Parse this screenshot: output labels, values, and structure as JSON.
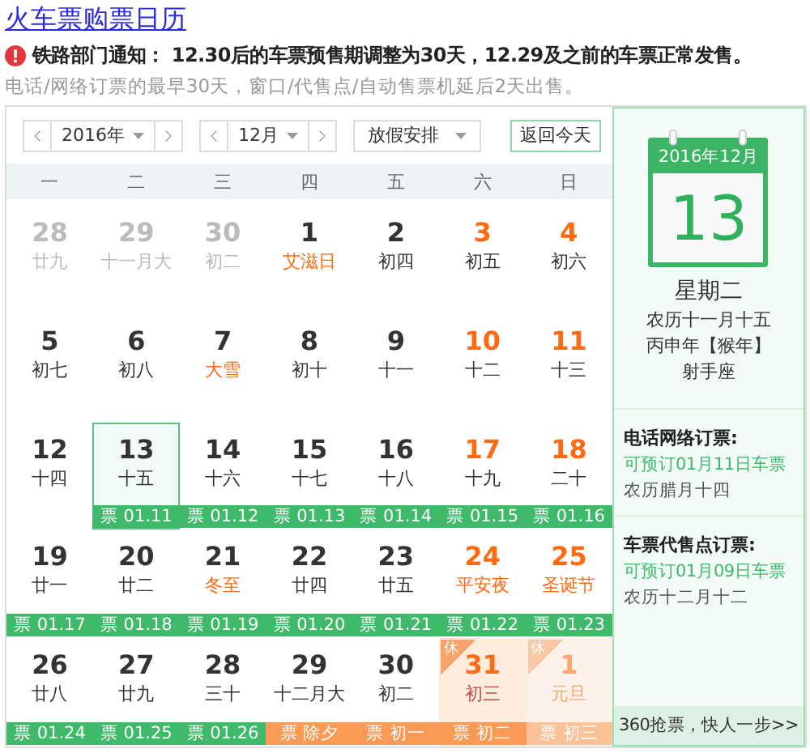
{
  "title": "火车票购票日历",
  "notice": {
    "label": "铁路部门通知：",
    "text": "12.30后的车票预售期调整为30天，12.29及之前的车票正常发售。"
  },
  "subtitle": "电话/网络订票的最早30天，窗口/代售点/自动售票机延后2天出售。",
  "toolbar": {
    "year": "2016年",
    "month": "12月",
    "holiday_select": "放假安排",
    "today_button": "返回今天"
  },
  "weekdays": [
    "一",
    "二",
    "三",
    "四",
    "五",
    "六",
    "日"
  ],
  "weeks": [
    [
      {
        "day": "28",
        "lunar": "廿九",
        "other_month": true,
        "weekend": false,
        "festival": false
      },
      {
        "day": "29",
        "lunar": "十一月大",
        "other_month": true,
        "weekend": false,
        "festival": false
      },
      {
        "day": "30",
        "lunar": "初二",
        "other_month": true,
        "weekend": false,
        "festival": false
      },
      {
        "day": "1",
        "lunar": "艾滋日",
        "other_month": false,
        "weekend": false,
        "festival": true
      },
      {
        "day": "2",
        "lunar": "初四",
        "other_month": false,
        "weekend": false,
        "festival": false
      },
      {
        "day": "3",
        "lunar": "初五",
        "other_month": false,
        "weekend": true,
        "festival": false
      },
      {
        "day": "4",
        "lunar": "初六",
        "other_month": false,
        "weekend": true,
        "festival": false
      }
    ],
    [
      {
        "day": "5",
        "lunar": "初七",
        "other_month": false,
        "weekend": false,
        "festival": false
      },
      {
        "day": "6",
        "lunar": "初八",
        "other_month": false,
        "weekend": false,
        "festival": false
      },
      {
        "day": "7",
        "lunar": "大雪",
        "other_month": false,
        "weekend": false,
        "festival": true
      },
      {
        "day": "8",
        "lunar": "初十",
        "other_month": false,
        "weekend": false,
        "festival": false
      },
      {
        "day": "9",
        "lunar": "十一",
        "other_month": false,
        "weekend": false,
        "festival": false
      },
      {
        "day": "10",
        "lunar": "十二",
        "other_month": false,
        "weekend": true,
        "festival": false
      },
      {
        "day": "11",
        "lunar": "十三",
        "other_month": false,
        "weekend": true,
        "festival": false
      }
    ],
    [
      {
        "day": "12",
        "lunar": "十四",
        "other_month": false,
        "weekend": false,
        "festival": false
      },
      {
        "day": "13",
        "lunar": "十五",
        "other_month": false,
        "weekend": false,
        "festival": false,
        "selected": true,
        "ticket": {
          "text": "票 01.11",
          "kind": "regular"
        }
      },
      {
        "day": "14",
        "lunar": "十六",
        "other_month": false,
        "weekend": false,
        "festival": false,
        "ticket": {
          "text": "票 01.12",
          "kind": "regular"
        }
      },
      {
        "day": "15",
        "lunar": "十七",
        "other_month": false,
        "weekend": false,
        "festival": false,
        "ticket": {
          "text": "票 01.13",
          "kind": "regular"
        }
      },
      {
        "day": "16",
        "lunar": "十八",
        "other_month": false,
        "weekend": false,
        "festival": false,
        "ticket": {
          "text": "票 01.14",
          "kind": "regular"
        }
      },
      {
        "day": "17",
        "lunar": "十九",
        "other_month": false,
        "weekend": true,
        "festival": false,
        "ticket": {
          "text": "票 01.15",
          "kind": "regular"
        }
      },
      {
        "day": "18",
        "lunar": "二十",
        "other_month": false,
        "weekend": true,
        "festival": false,
        "ticket": {
          "text": "票 01.16",
          "kind": "regular"
        }
      }
    ],
    [
      {
        "day": "19",
        "lunar": "廿一",
        "other_month": false,
        "weekend": false,
        "festival": false,
        "ticket": {
          "text": "票 01.17",
          "kind": "regular"
        }
      },
      {
        "day": "20",
        "lunar": "廿二",
        "other_month": false,
        "weekend": false,
        "festival": false,
        "ticket": {
          "text": "票 01.18",
          "kind": "regular"
        }
      },
      {
        "day": "21",
        "lunar": "冬至",
        "other_month": false,
        "weekend": false,
        "festival": true,
        "ticket": {
          "text": "票 01.19",
          "kind": "regular"
        }
      },
      {
        "day": "22",
        "lunar": "廿四",
        "other_month": false,
        "weekend": false,
        "festival": false,
        "ticket": {
          "text": "票 01.20",
          "kind": "regular"
        }
      },
      {
        "day": "23",
        "lunar": "廿五",
        "other_month": false,
        "weekend": false,
        "festival": false,
        "ticket": {
          "text": "票 01.21",
          "kind": "regular"
        }
      },
      {
        "day": "24",
        "lunar": "平安夜",
        "other_month": false,
        "weekend": true,
        "festival": true,
        "ticket": {
          "text": "票 01.22",
          "kind": "regular"
        }
      },
      {
        "day": "25",
        "lunar": "圣诞节",
        "other_month": false,
        "weekend": true,
        "festival": true,
        "ticket": {
          "text": "票 01.23",
          "kind": "regular"
        }
      }
    ],
    [
      {
        "day": "26",
        "lunar": "廿八",
        "other_month": false,
        "weekend": false,
        "festival": false,
        "ticket": {
          "text": "票 01.24",
          "kind": "regular"
        }
      },
      {
        "day": "27",
        "lunar": "廿九",
        "other_month": false,
        "weekend": false,
        "festival": false,
        "ticket": {
          "text": "票 01.25",
          "kind": "regular"
        }
      },
      {
        "day": "28",
        "lunar": "三十",
        "other_month": false,
        "weekend": false,
        "festival": false,
        "ticket": {
          "text": "票 01.26",
          "kind": "regular"
        }
      },
      {
        "day": "29",
        "lunar": "十二月大",
        "other_month": false,
        "weekend": false,
        "festival": false,
        "ticket": {
          "text": "票 除夕",
          "kind": "spring"
        }
      },
      {
        "day": "30",
        "lunar": "初二",
        "other_month": false,
        "weekend": false,
        "festival": false,
        "ticket": {
          "text": "票 初一",
          "kind": "spring"
        }
      },
      {
        "day": "31",
        "lunar": "初三",
        "other_month": false,
        "weekend": true,
        "festival": false,
        "rest": "休",
        "ticket": {
          "text": "票 初二",
          "kind": "spring"
        }
      },
      {
        "day": "1",
        "lunar": "元旦",
        "other_month": true,
        "weekend": true,
        "festival": true,
        "rest": "休",
        "ticket": {
          "text": "票 初三",
          "kind": "spring"
        }
      }
    ]
  ],
  "side": {
    "month": "2016年12月",
    "day": "13",
    "weekday": "星期二",
    "lunar": "农历十一月十五",
    "year": "丙申年【猴年】",
    "zodiac": "射手座",
    "sections": [
      {
        "heading": "电话网络订票:",
        "bookable": "可预订01月11日车票",
        "lunar": "农历腊月十四"
      },
      {
        "heading": "车票代售点订票:",
        "bookable": "可预订01月09日车票",
        "lunar": "农历十二月十二"
      }
    ],
    "footer": "360抢票，快人一步>>"
  }
}
